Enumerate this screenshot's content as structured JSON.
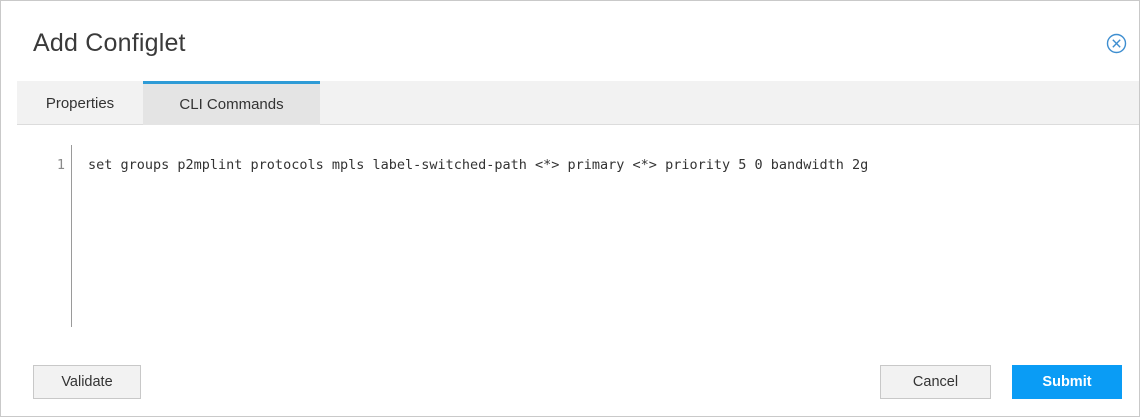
{
  "dialog": {
    "title": "Add Configlet"
  },
  "tabs": [
    {
      "label": "Properties",
      "active": false
    },
    {
      "label": "CLI Commands",
      "active": true
    }
  ],
  "editor": {
    "lines": [
      {
        "number": "1",
        "text": "set groups p2mplint protocols mpls label-switched-path <*> primary <*> priority 5 0 bandwidth 2g"
      }
    ]
  },
  "footer": {
    "validate_label": "Validate",
    "cancel_label": "Cancel",
    "submit_label": "Submit"
  },
  "colors": {
    "accent": "#2e9bd6",
    "submit": "#0a9cf5",
    "close_icon": "#3e8ed0"
  },
  "icons": {
    "close": "close-circle-x-icon"
  }
}
